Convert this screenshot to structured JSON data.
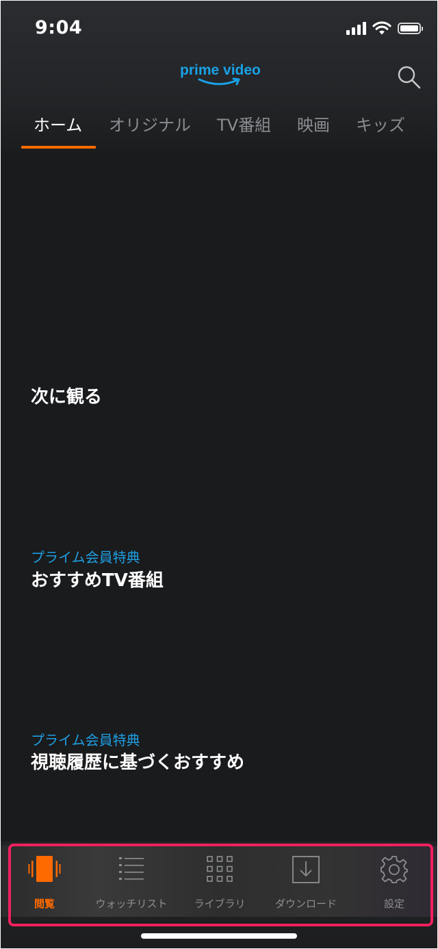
{
  "status_bar": {
    "time": "9:04"
  },
  "header": {
    "brand": "prime video",
    "brand_color": "#1aa1e6"
  },
  "tabs": [
    {
      "label": "ホーム",
      "active": true
    },
    {
      "label": "オリジナル",
      "active": false
    },
    {
      "label": "TV番組",
      "active": false
    },
    {
      "label": "映画",
      "active": false
    },
    {
      "label": "キッズ",
      "active": false
    }
  ],
  "sections": [
    {
      "subtitle": "",
      "title": "次に観る"
    },
    {
      "subtitle": "プライム会員特典",
      "title": "おすすめTV番組"
    },
    {
      "subtitle": "プライム会員特典",
      "title": "視聴履歴に基づくおすすめ"
    }
  ],
  "bottom_nav": [
    {
      "label": "閲覧",
      "icon": "browse-icon",
      "active": true
    },
    {
      "label": "ウォッチリスト",
      "icon": "watchlist-icon",
      "active": false
    },
    {
      "label": "ライブラリ",
      "icon": "library-icon",
      "active": false
    },
    {
      "label": "ダウンロード",
      "icon": "download-icon",
      "active": false
    },
    {
      "label": "設定",
      "icon": "gear-icon",
      "active": false
    }
  ],
  "colors": {
    "accent": "#ff6a00",
    "subtitle": "#1f9fe3",
    "highlight": "#f0205e",
    "background": "#1a1b1d"
  }
}
